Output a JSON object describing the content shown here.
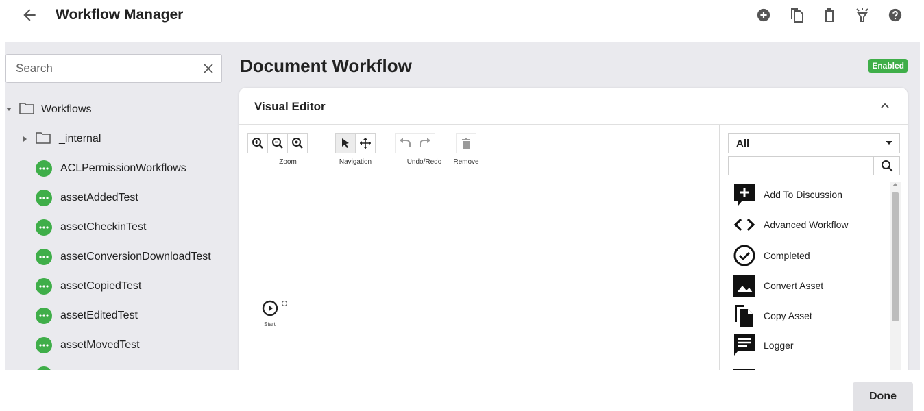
{
  "app": {
    "title": "Workflow Manager",
    "actions": [
      {
        "icon": "add-circle-icon"
      },
      {
        "icon": "copy-icon"
      },
      {
        "icon": "delete-icon"
      },
      {
        "icon": "lightbulb-icon"
      },
      {
        "icon": "help-icon"
      }
    ]
  },
  "sidebar": {
    "search": {
      "placeholder": "Search",
      "value": ""
    },
    "root": {
      "label": "Workflows",
      "expanded": true
    },
    "folder": {
      "label": "_internal",
      "expanded": false
    },
    "workflows": [
      "ACLPermissionWorkflows",
      "assetAddedTest",
      "assetCheckinTest",
      "assetConversionDownloadTest",
      "assetCopiedTest",
      "assetEditedTest",
      "assetMovedTest"
    ]
  },
  "document": {
    "title": "Document Workflow",
    "status": "Enabled",
    "status_color": "#3fae49"
  },
  "editor": {
    "title": "Visual Editor",
    "toolbar": {
      "zoom_label": "Zoom",
      "navigation_label": "Navigation",
      "undo_redo_label": "Undo/Redo",
      "remove_label": "Remove"
    },
    "start_node_label": "Start"
  },
  "palette": {
    "category": "All",
    "search_value": "",
    "items": [
      {
        "label": "Add To Discussion",
        "icon": "add-discussion-icon"
      },
      {
        "label": "Advanced Workflow",
        "icon": "code-icon"
      },
      {
        "label": "Completed",
        "icon": "check-circle-icon"
      },
      {
        "label": "Convert Asset",
        "icon": "image-icon"
      },
      {
        "label": "Copy Asset",
        "icon": "copy-file-icon"
      },
      {
        "label": "Logger",
        "icon": "message-icon"
      }
    ]
  },
  "footer": {
    "done_label": "Done"
  }
}
